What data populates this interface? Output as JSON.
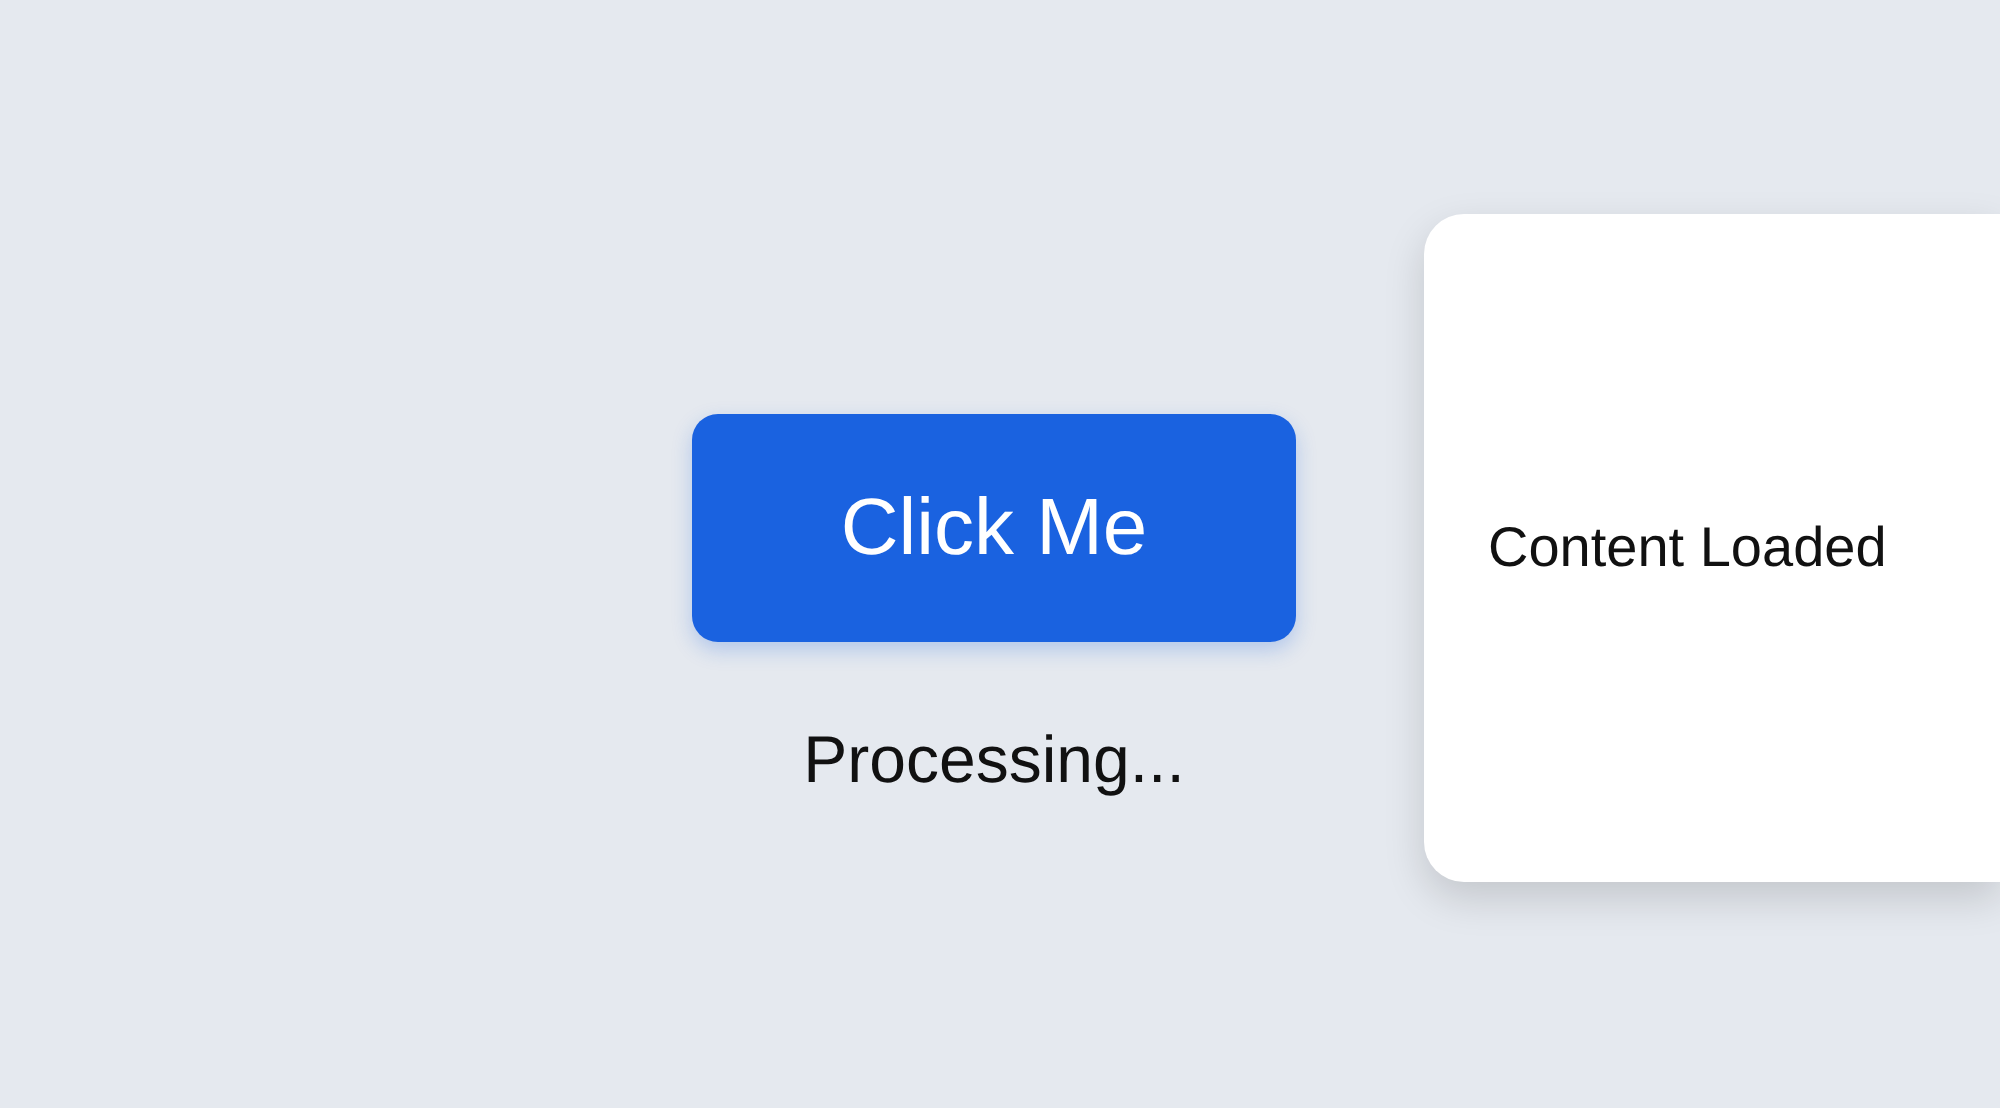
{
  "button": {
    "label": "Click Me"
  },
  "status": "Processing...",
  "card": {
    "text": "Content Loaded"
  }
}
